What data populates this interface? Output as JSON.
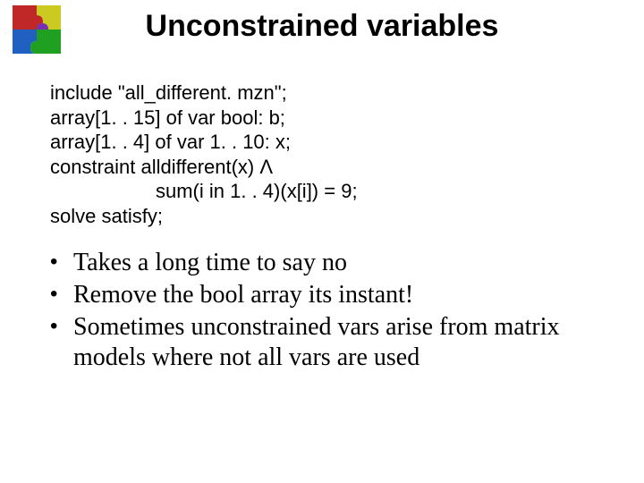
{
  "title": "Unconstrained variables",
  "code": {
    "l1": "include \"all_different. mzn\";",
    "l2": "array[1. . 15] of var bool: b;",
    "l3": "array[1. . 4] of var 1. . 10: x;",
    "l4": "constraint alldifferent(x) Λ",
    "l5": "sum(i in 1. . 4)(x[i]) = 9;",
    "l6": "solve satisfy;"
  },
  "bullets": [
    "Takes a long time to say no",
    "Remove the bool array its instant!",
    "Sometimes unconstrained vars arise from matrix models where not all vars are used"
  ],
  "logo_name": "puzzle-logo"
}
